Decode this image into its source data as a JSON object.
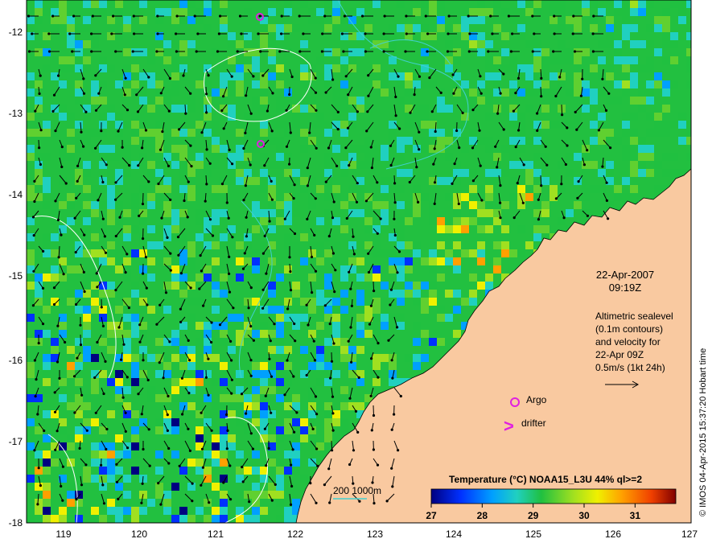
{
  "axes": {
    "lat_ticks": [
      "-12",
      "-13",
      "-14",
      "-15",
      "-16",
      "-17",
      "-18"
    ],
    "lon_ticks": [
      "119",
      "120",
      "121",
      "122",
      "123",
      "124",
      "125",
      "126",
      "127"
    ],
    "lon_range": [
      118.6,
      127.0
    ],
    "lat_range": [
      -18.0,
      -11.8
    ]
  },
  "annotation": {
    "date": "22-Apr-2007",
    "time": "09:19Z",
    "altimetry_lines": [
      "Altimetric sealevel",
      "(0.1m contours)",
      "and velocity for",
      "22-Apr 09Z",
      "0.5m/s (1kt 24h)"
    ]
  },
  "legend": {
    "argo_label": "Argo",
    "drifter_label": "drifter",
    "drifter_symbol": ">",
    "argo_color": "#e020e0",
    "drifter_color": "#e020e0"
  },
  "bathymetry": {
    "label": "200  1000m",
    "color": "#40d0d0"
  },
  "colorbar": {
    "title": "Temperature (°C) NOAA15_L3U 44% ql>=2",
    "ticks": [
      "27",
      "28",
      "29",
      "30",
      "31"
    ],
    "range": [
      27,
      31.8
    ]
  },
  "credit": "© IMOS 04-Apr-2015 15:37:20 Hobart time",
  "colors": {
    "land": "#f9c9a0",
    "sst_base": "#22c040",
    "arrow": "#000000",
    "contour": "#ffffff"
  }
}
